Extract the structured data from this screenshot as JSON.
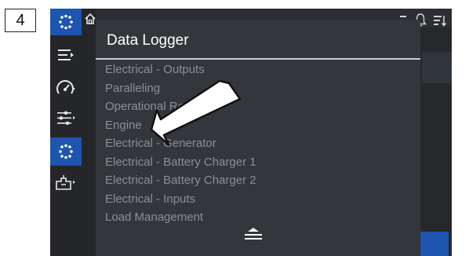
{
  "step": {
    "number": "4"
  },
  "menu": {
    "title": "Data Logger",
    "items": [
      "Electrical - Outputs",
      "Paralleling",
      "Operational Records",
      "Engine",
      "Electrical - Generator",
      "Electrical - Battery Charger 1",
      "Electrical - Battery Charger 2",
      "Electrical - Inputs",
      "Load Management"
    ]
  },
  "sidebar": {
    "icons": [
      "data-logger-icon",
      "menu-icon",
      "gauge-icon",
      "sliders-icon",
      "data-logger-icon",
      "power-flow-icon"
    ],
    "active_index": 4
  },
  "topbar": {
    "icons": [
      "home-icon",
      "minimize-icon",
      "bell-icon",
      "sort-icon"
    ]
  },
  "colors": {
    "accent": "#1e55b0",
    "background": "#26282c",
    "menu_bg": "#33363b",
    "text_primary": "#ffffff",
    "text_muted": "#8b8f95"
  }
}
